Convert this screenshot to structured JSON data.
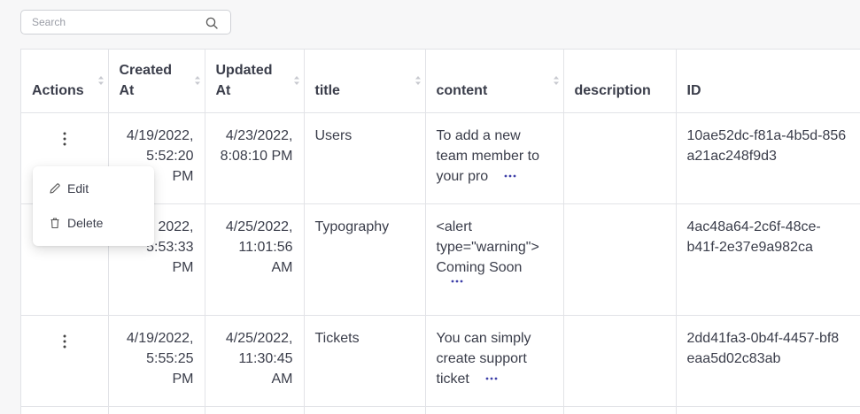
{
  "search": {
    "placeholder": "Search"
  },
  "table": {
    "headers": {
      "actions": "Actions",
      "created_line1": "Created",
      "created_line2": "At",
      "updated_line1": "Updated",
      "updated_line2": "At",
      "title": "title",
      "content": "content",
      "description": "description",
      "id": "ID"
    },
    "rows": [
      {
        "created": [
          "4/19/2022,",
          "5:52:20",
          "PM"
        ],
        "updated": [
          "4/23/2022,",
          "8:08:10 PM"
        ],
        "title": "Users",
        "content": [
          "To add a new",
          "team member to",
          "your pro"
        ],
        "description": "",
        "id": [
          "10ae52dc-f81a-4b5d-856",
          "a21ac248f9d3"
        ]
      },
      {
        "created": [
          "2022,",
          "5:53:33",
          "PM"
        ],
        "updated": [
          "4/25/2022,",
          "11:01:56",
          "AM"
        ],
        "title": "Typography",
        "content": [
          "<alert",
          "type=\"warning\">",
          "Coming Soon"
        ],
        "description": "",
        "id": [
          "4ac48a64-2c6f-48ce-",
          "b41f-2e37e9a982ca"
        ]
      },
      {
        "created": [
          "4/19/2022,",
          "5:55:25",
          "PM"
        ],
        "updated": [
          "4/25/2022,",
          "11:30:45",
          "AM"
        ],
        "title": "Tickets",
        "content": [
          "You can simply",
          "create support",
          "ticket"
        ],
        "description": "",
        "id": [
          "2dd41fa3-0b4f-4457-bf8",
          "eaa5d02c83ab"
        ]
      }
    ]
  },
  "menu": {
    "edit_label": "Edit",
    "delete_label": "Delete"
  },
  "colors": {
    "accent": "#3d3fa8",
    "border": "#e2e3e7",
    "text": "#3a3d4a"
  },
  "icons": {
    "search": "search-icon",
    "sort": "sort-icon",
    "kebab": "kebab-icon",
    "more": "more-horizontal-icon",
    "edit": "pencil-icon",
    "delete": "trash-icon"
  }
}
